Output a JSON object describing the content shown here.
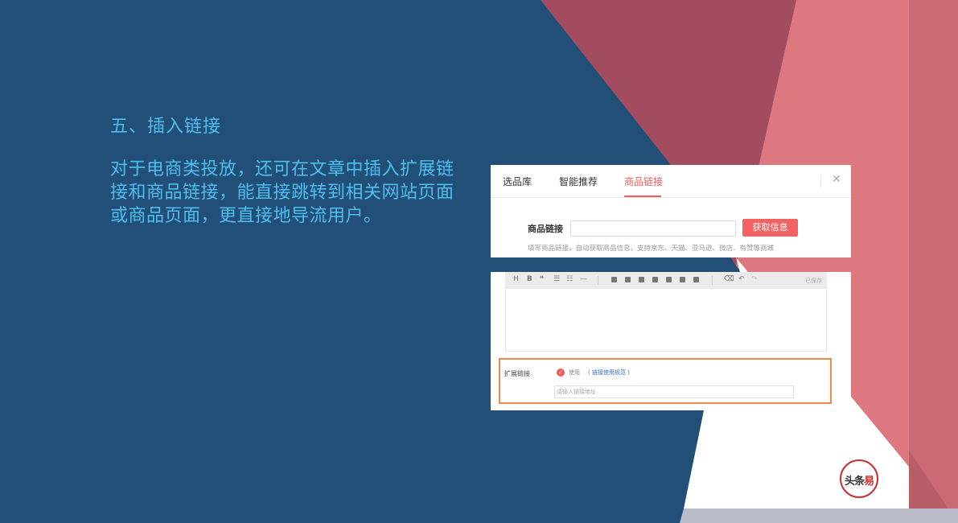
{
  "slide": {
    "heading": "五、插入链接",
    "body": "对于电商类投放，还可在文章中插入扩展链接和商品链接，能直接跳转到相关网站页面或商品页面，更直接地导流用户。"
  },
  "colors": {
    "background": "#214f78",
    "accent_text": "#50bdf0",
    "dark_red": "#a34c60",
    "pink": "#de7880",
    "highlight_border": "#f08a4b"
  },
  "panel_top": {
    "tabs": [
      "选品库",
      "智能推荐",
      "商品链接"
    ],
    "active_tab": "商品链接",
    "close_icon": "close-icon",
    "product_link_label": "商品链接",
    "product_link_value": "",
    "fetch_button": "获取信息",
    "hint": "填写商品链接，自动获取商品信息，支持京东、天猫、亚马逊、微店、有赞等商城"
  },
  "panel_editor": {
    "toolbar_icons": [
      "heading-icon",
      "bold-icon",
      "quote-icon",
      "bullet-list-icon",
      "numbered-list-icon",
      "divider-icon",
      "file-icon",
      "image-icon",
      "gallery-icon",
      "audio-icon",
      "video-icon",
      "product-icon",
      "font-icon",
      "eraser-icon",
      "undo-icon",
      "redo-icon"
    ],
    "toolbar_glyphs": {
      "h": "H",
      "b": "B",
      "quote": "❝",
      "ul": "☰",
      "ol": "☷",
      "hr": "—",
      "undo": "↶",
      "redo": "↷",
      "eraser": "⌫"
    },
    "saved_status": "已保存",
    "ext_link_label": "扩展链接",
    "use_label": "使用",
    "rule_link": "( 链接使用规范 )",
    "url_placeholder": "请输入链接地址",
    "checkbox_checked": true
  },
  "logo": {
    "text_a": "头条",
    "text_b": "易"
  }
}
